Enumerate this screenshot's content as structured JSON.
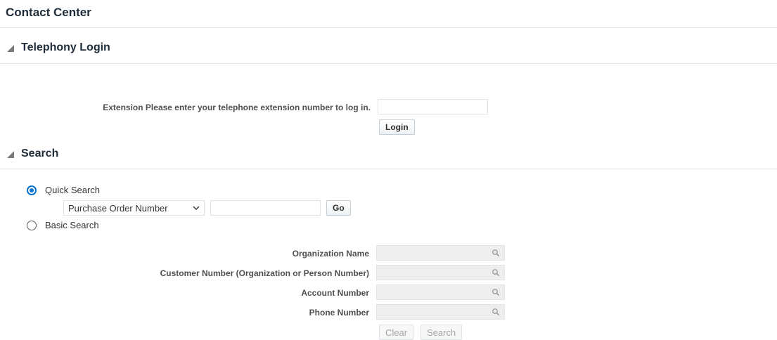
{
  "page": {
    "title": "Contact Center"
  },
  "telephony": {
    "section_title": "Telephony Login",
    "extension_label": "Extension Please enter your telephone extension number to log in.",
    "extension_value": "",
    "login_label": "Login"
  },
  "search": {
    "section_title": "Search",
    "quick_label": "Quick Search",
    "quick_selected": true,
    "quick_field_selected": "Purchase Order Number",
    "quick_value": "",
    "go_label": "Go",
    "basic_label": "Basic Search",
    "fields": [
      {
        "label": "Organization Name",
        "value": ""
      },
      {
        "label": "Customer Number (Organization or Person Number)",
        "value": ""
      },
      {
        "label": "Account Number",
        "value": ""
      },
      {
        "label": "Phone Number",
        "value": ""
      }
    ],
    "clear_label": "Clear",
    "search_label": "Search"
  },
  "icons": {
    "section_toggle": "expanded-triangle-icon",
    "dropdown": "chevron-down-icon",
    "lov": "search-magnifier-icon"
  },
  "colors": {
    "accent": "#0572ce",
    "disabled_field": "#eeeeee",
    "rule": "#dfe3e7"
  }
}
